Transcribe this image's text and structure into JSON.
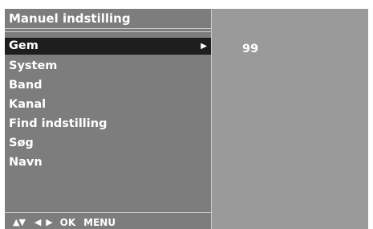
{
  "panel": {
    "title": "Manuel indstilling"
  },
  "menu": {
    "items": [
      {
        "label": "Gem",
        "selected": true,
        "submenu_icon": "triangle-right-icon"
      },
      {
        "label": "System"
      },
      {
        "label": "Band"
      },
      {
        "label": "Kanal"
      },
      {
        "label": "Find indstilling"
      },
      {
        "label": "Søg"
      },
      {
        "label": "Navn"
      }
    ]
  },
  "footer": {
    "updown_glyph": "▲▼",
    "leftright_glyph": "◀ ▶",
    "ok_label": "OK",
    "menu_label": "MENU"
  },
  "value_panel": {
    "value": "99"
  },
  "colors": {
    "screen_bg": "#9a9a9a",
    "menu_bg": "#7d7d7d",
    "selected_bg": "#1e1e1e",
    "text": "#ffffff"
  }
}
